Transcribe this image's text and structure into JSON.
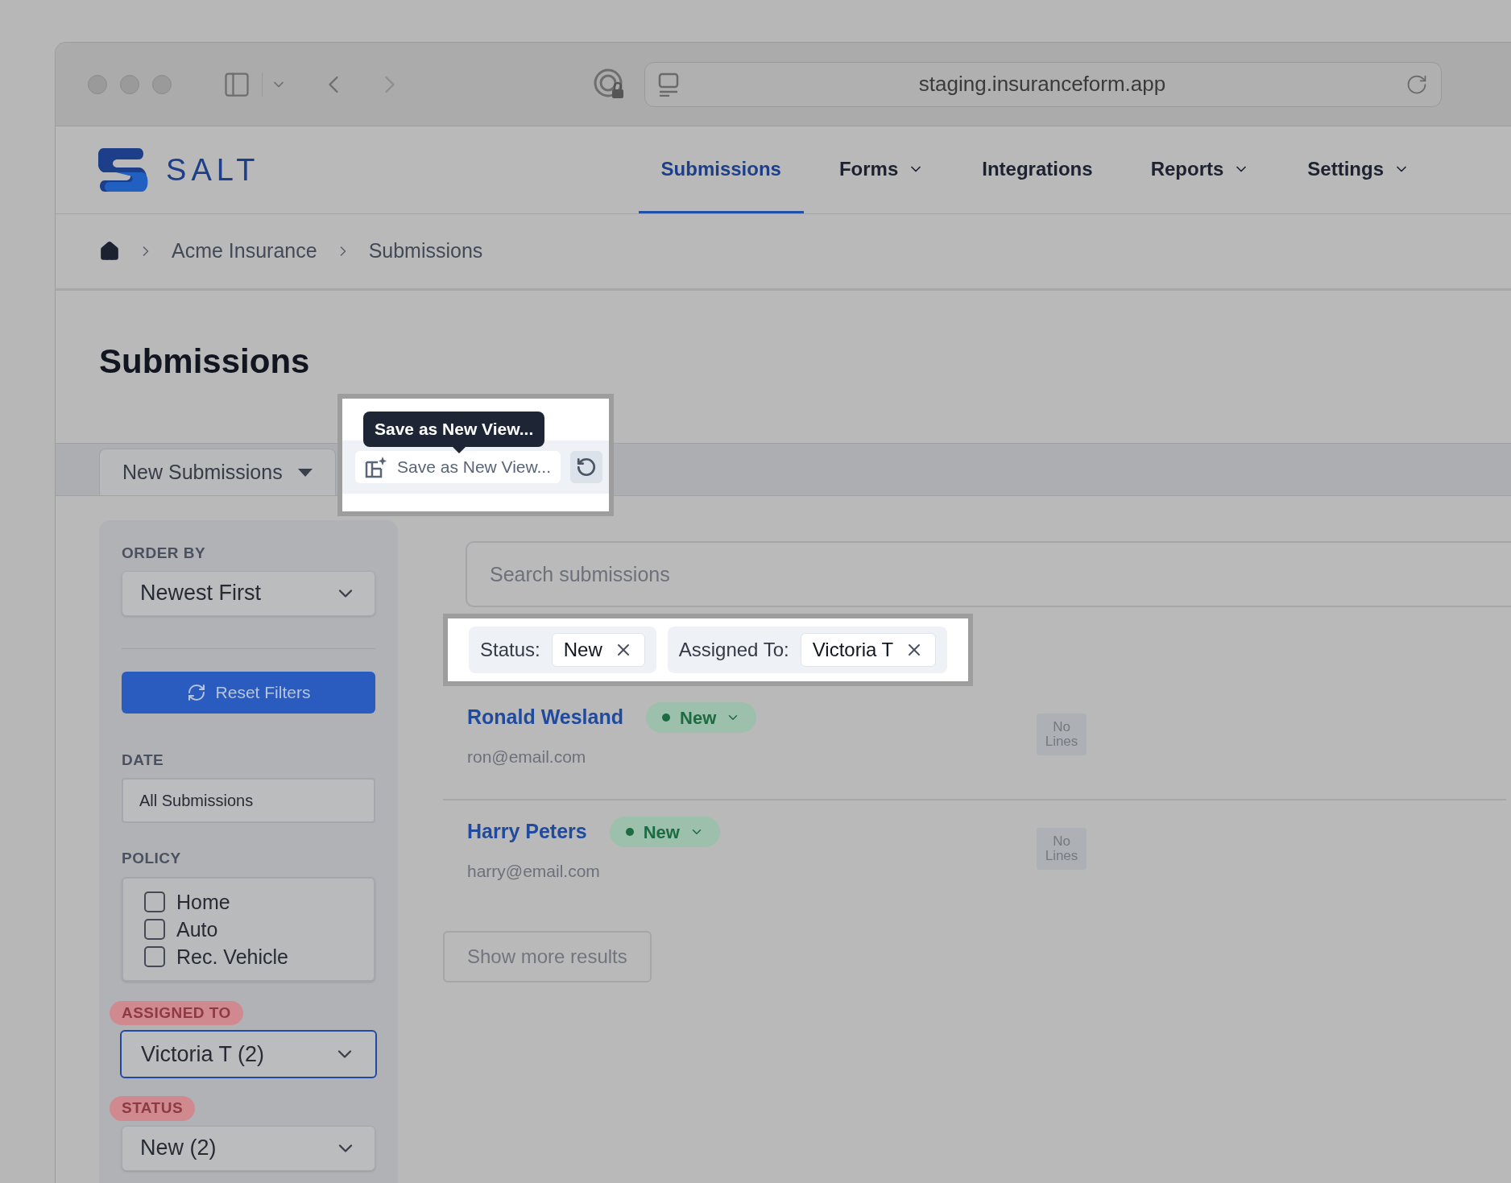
{
  "browser": {
    "url": "staging.insuranceform.app"
  },
  "header": {
    "logo": "SALT",
    "nav": [
      {
        "label": "Submissions",
        "selected": true,
        "dropdown": false
      },
      {
        "label": "Forms",
        "selected": false,
        "dropdown": true
      },
      {
        "label": "Integrations",
        "selected": false,
        "dropdown": false
      },
      {
        "label": "Reports",
        "selected": false,
        "dropdown": true
      },
      {
        "label": "Settings",
        "selected": false,
        "dropdown": true
      }
    ]
  },
  "breadcrumb": [
    "Acme Insurance",
    "Submissions"
  ],
  "page_title": "Submissions",
  "view_tab": {
    "label": "New Submissions"
  },
  "tooltip": "Save as New View...",
  "save_view_button": "Save as New View...",
  "sidebar": {
    "order_by": {
      "label": "ORDER BY",
      "value": "Newest First",
      "highlighted": false,
      "focused": false
    },
    "reset_button": "Reset Filters",
    "date": {
      "label": "DATE",
      "value": "All Submissions"
    },
    "policy": {
      "label": "POLICY",
      "options": [
        {
          "label": "Home",
          "checked": false
        },
        {
          "label": "Auto",
          "checked": false
        },
        {
          "label": "Rec. Vehicle",
          "checked": false
        }
      ]
    },
    "assigned_to": {
      "label": "ASSIGNED TO",
      "value": "Victoria T (2)",
      "highlighted": true,
      "focused": true
    },
    "status": {
      "label": "STATUS",
      "value": "New (2)",
      "highlighted": true,
      "focused": false
    }
  },
  "search": {
    "placeholder": "Search submissions"
  },
  "active_filters": [
    {
      "label": "Status:",
      "value": "New"
    },
    {
      "label": "Assigned To:",
      "value": "Victoria T"
    }
  ],
  "submissions": [
    {
      "name": "Ronald Wesland",
      "status": "New",
      "email": "ron@email.com",
      "lines": "No Lines"
    },
    {
      "name": "Harry Peters",
      "status": "New",
      "email": "harry@email.com",
      "lines": "No Lines"
    }
  ],
  "show_more": "Show more results"
}
